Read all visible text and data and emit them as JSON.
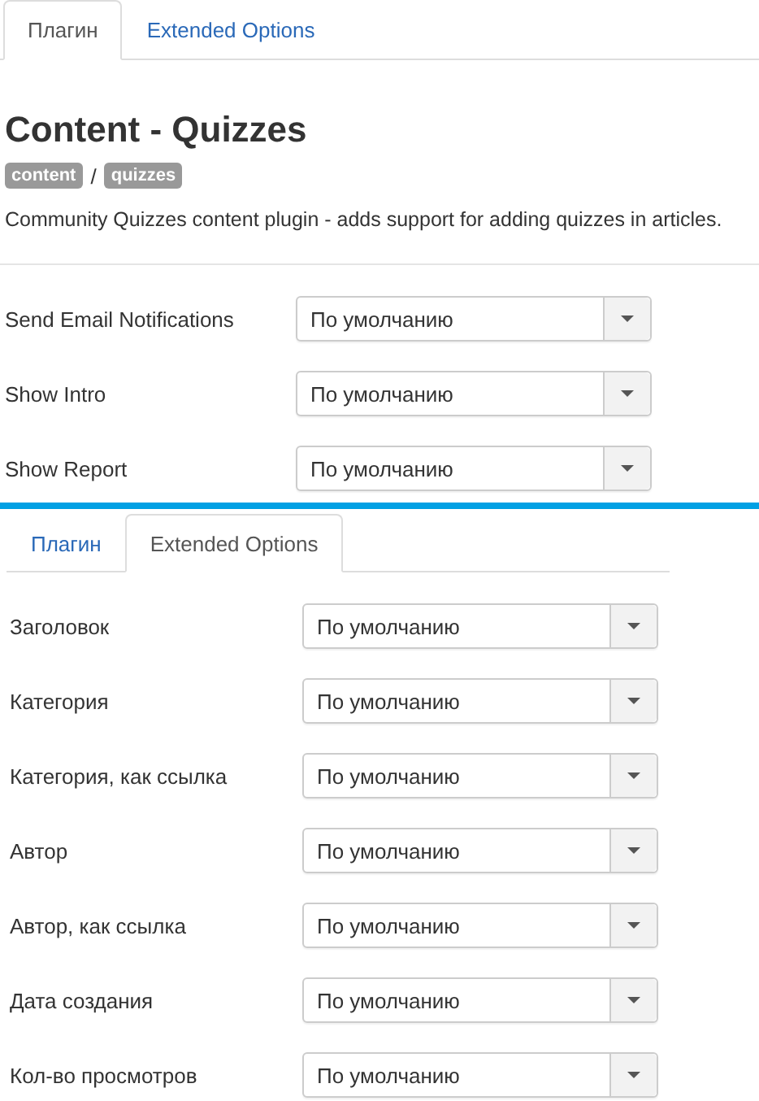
{
  "panels": [
    {
      "tabs": [
        {
          "label": "Плагин",
          "selected": true
        },
        {
          "label": "Extended Options",
          "selected": false
        }
      ],
      "header": {
        "title": "Content - Quizzes",
        "tags": [
          "content",
          "quizzes"
        ],
        "separator": "/",
        "description": "Community Quizzes content plugin - adds support for adding quizzes in articles."
      },
      "fields": [
        {
          "label": "Send Email Notifications",
          "value": "По умолчанию"
        },
        {
          "label": "Show Intro",
          "value": "По умолчанию"
        },
        {
          "label": "Show Report",
          "value": "По умолчанию"
        }
      ]
    },
    {
      "tabs": [
        {
          "label": "Плагин",
          "selected": false
        },
        {
          "label": "Extended Options",
          "selected": true
        }
      ],
      "fields": [
        {
          "label": "Заголовок",
          "value": "По умолчанию"
        },
        {
          "label": "Категория",
          "value": "По умолчанию"
        },
        {
          "label": "Категория, как ссылка",
          "value": "По умолчанию"
        },
        {
          "label": "Автор",
          "value": "По умолчанию"
        },
        {
          "label": "Автор, как ссылка",
          "value": "По умолчанию"
        },
        {
          "label": "Дата создания",
          "value": "По умолчанию"
        },
        {
          "label": "Кол-во просмотров",
          "value": "По умолчанию"
        }
      ]
    }
  ]
}
